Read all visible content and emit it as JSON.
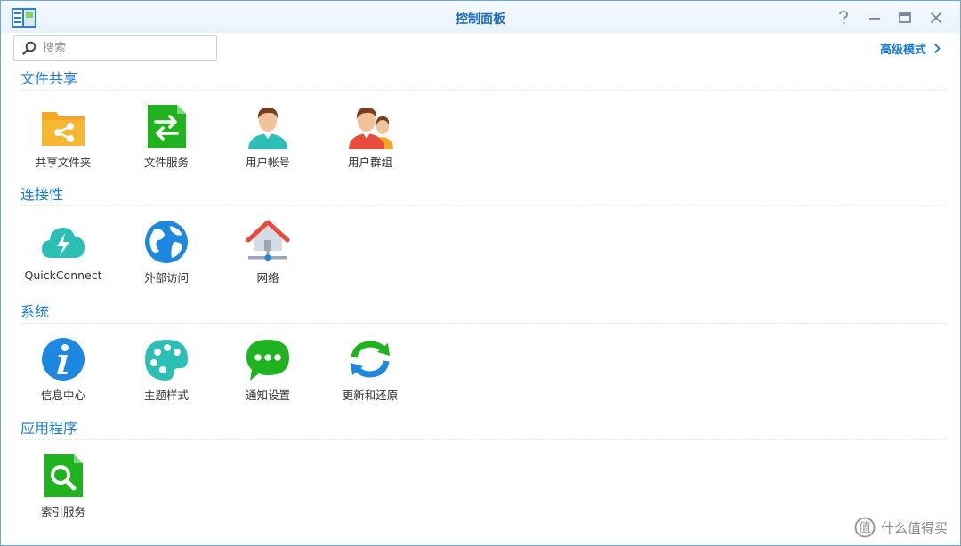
{
  "window": {
    "title": "控制面板"
  },
  "search": {
    "placeholder": "搜索"
  },
  "advanced_mode": {
    "label": "高级模式"
  },
  "sections": [
    {
      "title": "文件共享",
      "items": [
        {
          "label": "共享文件夹",
          "icon": "shared-folder-icon"
        },
        {
          "label": "文件服务",
          "icon": "file-services-icon"
        },
        {
          "label": "用户帐号",
          "icon": "user-icon"
        },
        {
          "label": "用户群组",
          "icon": "group-icon"
        }
      ]
    },
    {
      "title": "连接性",
      "items": [
        {
          "label": "QuickConnect",
          "icon": "quickconnect-icon"
        },
        {
          "label": "外部访问",
          "icon": "external-access-icon"
        },
        {
          "label": "网络",
          "icon": "network-icon"
        }
      ]
    },
    {
      "title": "系统",
      "items": [
        {
          "label": "信息中心",
          "icon": "info-center-icon"
        },
        {
          "label": "主题样式",
          "icon": "theme-icon"
        },
        {
          "label": "通知设置",
          "icon": "notification-icon"
        },
        {
          "label": "更新和还原",
          "icon": "update-restore-icon"
        }
      ]
    },
    {
      "title": "应用程序",
      "items": [
        {
          "label": "索引服务",
          "icon": "indexing-service-icon"
        }
      ]
    }
  ],
  "watermark": {
    "text": "什么值得买"
  },
  "colors": {
    "accent": "#1a7ad4",
    "title": "#1a6bbf",
    "folder_orange": "#f5a623",
    "green": "#1fb31f",
    "teal": "#2cbfb5",
    "blue": "#1e87e0",
    "red": "#e94b3c"
  }
}
